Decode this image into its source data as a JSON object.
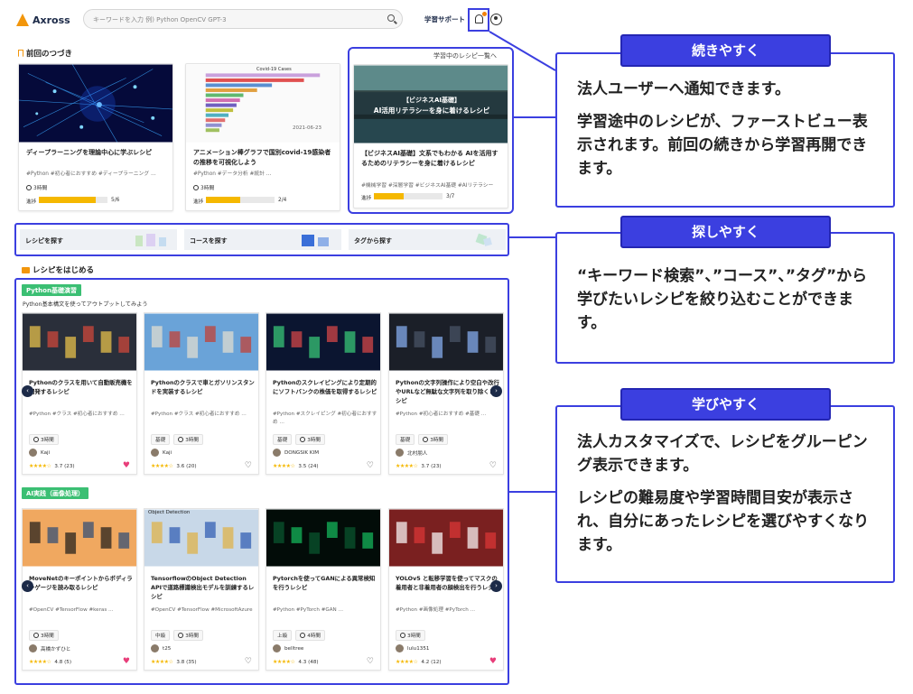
{
  "header": {
    "logo_text": "Axross",
    "search_placeholder": "キーワードを入力 例) Python OpenCV GPT-3",
    "support_label": "学習サポート",
    "bell_icon": "bell-icon",
    "avatar_icon": "user-icon"
  },
  "continue_section": {
    "title": "前回のつづき",
    "link_all": "学習中のレシピ一覧へ",
    "cards": [
      {
        "title": "ディープラーニングを理論中心に学ぶレシピ",
        "tags": "#Python #初心者におすすめ #ディープラーニング …",
        "time": "3時間",
        "progress_label": "進捗",
        "progress": 0.83,
        "progress_text": "5/6"
      },
      {
        "title": "アニメーション棒グラフで国別covid-19感染者の推移を可視化しよう",
        "tags": "#Python #データ分析 #統計 …",
        "time": "3時間",
        "progress_label": "進捗",
        "progress": 0.5,
        "progress_text": "2/4",
        "chart_title": "Covid-19 Cases",
        "chart_date": "2021-06-23"
      },
      {
        "title": "【ビジネスAI基礎】文系でもわかる AIを活用するためのリテラシーを身に着けるレシピ",
        "tags": "#機械学習 #深層学習 #ビジネスAI基礎 #AIリテラシー",
        "time": "3時間",
        "progress_label": "進捗",
        "progress": 0.43,
        "progress_text": "3/7",
        "banner_line1": "【ビジネスAI基礎】",
        "banner_line2": "AI活用リテラシーを身に着けるレシピ"
      }
    ]
  },
  "find": {
    "recipe": "レシピを探す",
    "course": "コースを探す",
    "tag": "タグから探す"
  },
  "start_section": {
    "title": "レシピをはじめる",
    "groups": [
      {
        "badge": "Python基礎演習",
        "subtitle": "Python基本構文を使ってアウトプットしてみよう",
        "cards": [
          {
            "title": "Pythonのクラスを用いて自動販売機を開発するレシピ",
            "tags": "#Python #クラス #初心者におすすめ …",
            "level": "",
            "time": "3時間",
            "author": "Kaji",
            "rating": "3.7 (23)",
            "heart": "filled"
          },
          {
            "title": "Pythonのクラスで車とガソリンスタンドを実装するレシピ",
            "tags": "#Python #クラス #初心者におすすめ …",
            "level": "基礎",
            "time": "3時間",
            "author": "Kaji",
            "rating": "3.6 (20)",
            "heart": "outline"
          },
          {
            "title": "Pythonのスクレイピングにより定期的にソフトバンクの株価を取得するレシピ",
            "tags": "#Python #スクレイピング #初心者におすすめ …",
            "level": "基礎",
            "time": "3時間",
            "author": "DONGSIK KIM",
            "rating": "3.5 (24)",
            "heart": "outline"
          },
          {
            "title": "Pythonの文字列操作により空白や改行やURLなど無駄な文字列を取り除くレシピ",
            "tags": "#Python #初心者におすすめ #基礎 …",
            "level": "基礎",
            "time": "3時間",
            "author": "北村朋人",
            "rating": "3.7 (23)",
            "heart": "outline"
          }
        ]
      },
      {
        "badge": "AI実践（画像処理）",
        "subtitle": "",
        "cards": [
          {
            "title": "MoveNetのキーポイントからボディランゲージを読み取るレシピ",
            "tags": "#OpenCV #TensorFlow #keras …",
            "level": "",
            "time": "3時間",
            "author": "高橋かずひと",
            "rating": "4.8 (5)",
            "heart": "filled"
          },
          {
            "title": "TensorflowのObject Detection APIで道路標識検出モデルを訓練するレシピ",
            "tags": "#OpenCV #TensorFlow #MicrosoftAzure",
            "level": "中級",
            "time": "3時間",
            "author": "t25",
            "rating": "3.8 (35)",
            "heart": "outline",
            "thumb_label": "Object Detection"
          },
          {
            "title": "Pytorchを使ってGANによる異常検知を行うレシピ",
            "tags": "#Python #PyTorch #GAN …",
            "level": "上級",
            "time": "4時間",
            "author": "belltree",
            "rating": "4.3 (48)",
            "heart": "outline"
          },
          {
            "title": "YOLOv5 と転移学習を使ってマスクの着用者と非着用者の顔検出を行うレシピ",
            "tags": "#Python #画像処理 #PyTorch …",
            "level": "",
            "time": "3時間",
            "author": "lulu1351",
            "rating": "4.2 (12)",
            "heart": "filled"
          }
        ]
      }
    ]
  },
  "callouts": [
    {
      "heading": "続きやすく",
      "paragraphs": [
        "法人ユーザーへ通知できます。",
        "学習途中のレシピが、ファーストビュー表示されます。前回の続きから学習再開できます。"
      ]
    },
    {
      "heading": "探しやすく",
      "paragraphs": [
        "“キーワード検索”、”コース”、”タグ”から学びたいレシピを絞り込むことができます。"
      ]
    },
    {
      "heading": "学びやすく",
      "paragraphs": [
        "法人カスタマイズで、レシピをグルーピング表示できます。",
        "レシピの難易度や学習時間目安が表示され、自分にあったレシピを選びやすくなります。"
      ]
    }
  ],
  "colors": {
    "accent": "#3b3fe0",
    "progress": "#f5b800",
    "badge": "#3bbf73",
    "navy": "#1c2a48",
    "heart": "#e83e7a"
  }
}
